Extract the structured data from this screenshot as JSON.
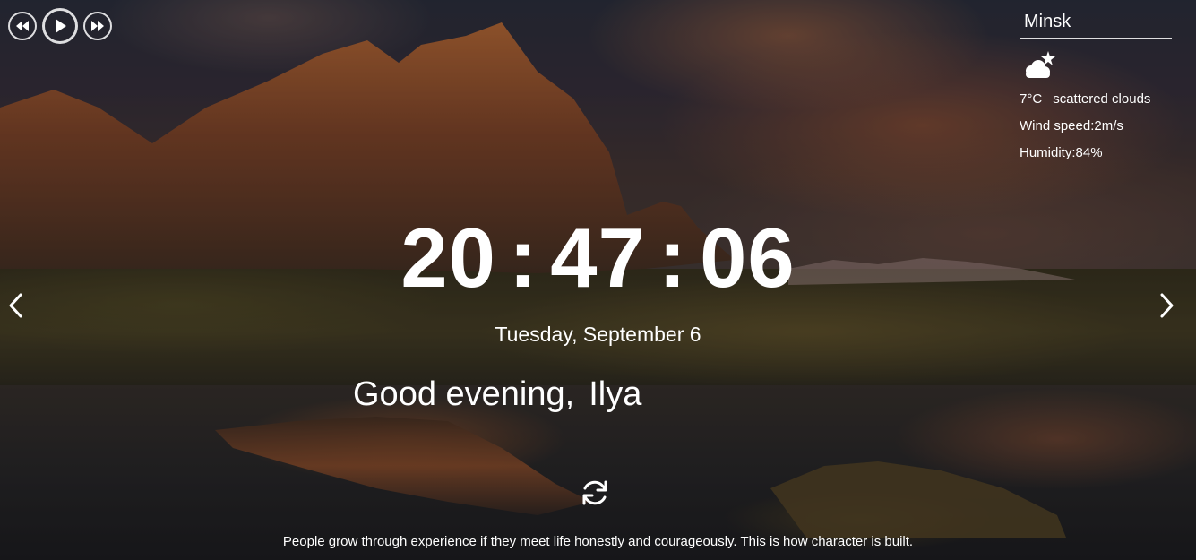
{
  "player": {
    "prev_icon": "rewind-icon",
    "play_icon": "play-icon",
    "next_icon": "fast-forward-icon"
  },
  "weather": {
    "city": "Minsk",
    "icon": "scattered-clouds-night-icon",
    "temperature": "7°C",
    "description": "scattered clouds",
    "wind": "Wind speed:2m/s",
    "humidity": "Humidity:84%"
  },
  "clock": {
    "hours": "20",
    "minutes": "47",
    "seconds": "06",
    "separator": ":"
  },
  "date": "Tuesday, September 6",
  "greeting": {
    "text": "Good evening,",
    "name": "Ilya"
  },
  "navigation": {
    "prev_icon": "chevron-left-icon",
    "next_icon": "chevron-right-icon"
  },
  "quote": {
    "refresh_icon": "refresh-icon",
    "text": "People grow through experience if they meet life honestly and courageously. This is how character is built."
  }
}
